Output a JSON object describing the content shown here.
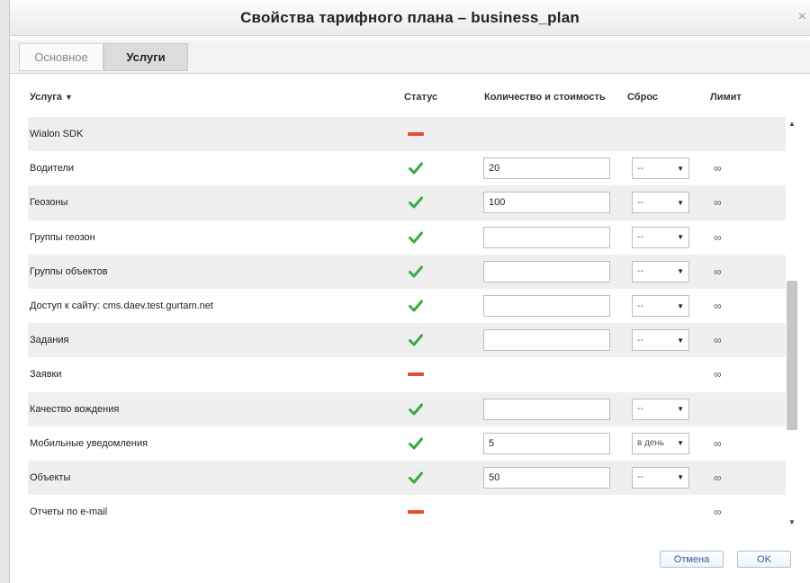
{
  "dialog": {
    "title": "Свойства тарифного плана – business_plan",
    "close_glyph": "×"
  },
  "tabs": [
    {
      "label": "Основное",
      "active": false
    },
    {
      "label": "Услуги",
      "active": true
    }
  ],
  "table": {
    "headers": {
      "service": "Услуга",
      "sort_glyph": "▼",
      "status": "Статус",
      "quantity_cost": "Количество и стоимость",
      "reset": "Сброс",
      "limit": "Лимит"
    },
    "rows": [
      {
        "name": "Wialon SDK",
        "status": "disabled",
        "has_inputs": false,
        "quantity": "",
        "reset": "",
        "limit": ""
      },
      {
        "name": "Водители",
        "status": "enabled",
        "has_inputs": true,
        "quantity": "20",
        "reset": "--",
        "limit": "∞"
      },
      {
        "name": "Геозоны",
        "status": "enabled",
        "has_inputs": true,
        "quantity": "100",
        "reset": "--",
        "limit": "∞"
      },
      {
        "name": "Группы геозон",
        "status": "enabled",
        "has_inputs": true,
        "quantity": "",
        "reset": "--",
        "limit": "∞"
      },
      {
        "name": "Группы объектов",
        "status": "enabled",
        "has_inputs": true,
        "quantity": "",
        "reset": "--",
        "limit": "∞"
      },
      {
        "name": "Доступ к сайту: cms.daev.test.gurtam.net",
        "status": "enabled",
        "has_inputs": true,
        "quantity": "",
        "reset": "--",
        "limit": "∞"
      },
      {
        "name": "Задания",
        "status": "enabled",
        "has_inputs": true,
        "quantity": "",
        "reset": "--",
        "limit": "∞"
      },
      {
        "name": "Заявки",
        "status": "disabled",
        "has_inputs": false,
        "quantity": "",
        "reset": "",
        "limit": "∞"
      },
      {
        "name": "Качество вождения",
        "status": "enabled",
        "has_inputs": true,
        "quantity": "",
        "reset": "--",
        "limit": ""
      },
      {
        "name": "Мобильные уведомления",
        "status": "enabled",
        "has_inputs": true,
        "quantity": "5",
        "reset": "в день",
        "limit": "∞"
      },
      {
        "name": "Объекты",
        "status": "enabled",
        "has_inputs": true,
        "quantity": "50",
        "reset": "--",
        "limit": "∞"
      },
      {
        "name": "Отчеты по e-mail",
        "status": "disabled",
        "has_inputs": false,
        "quantity": "",
        "reset": "",
        "limit": "∞"
      }
    ]
  },
  "status_icons": {
    "enabled": "check-icon",
    "disabled": "dash-icon"
  },
  "colors": {
    "enabled": "#3aab3a",
    "disabled": "#e84a3c",
    "button_text": "#2a5fa0"
  },
  "footer": {
    "cancel_label": "Отмена",
    "ok_label": "OK"
  }
}
